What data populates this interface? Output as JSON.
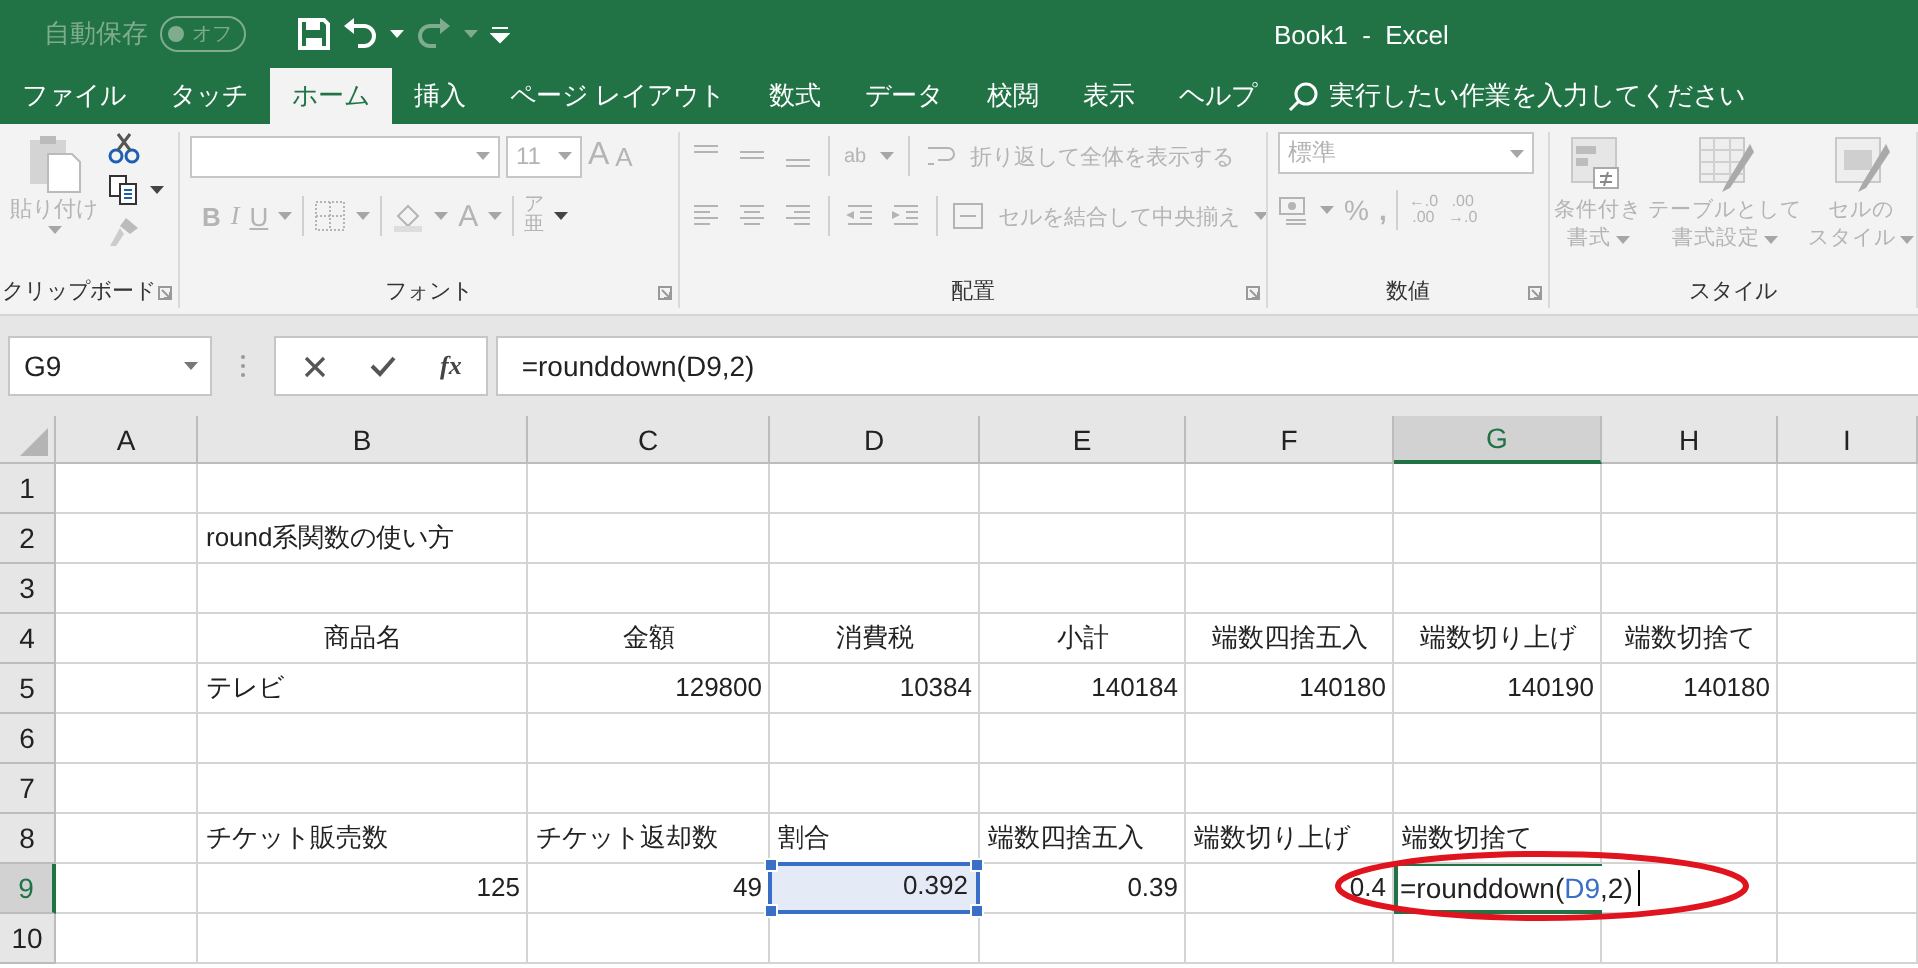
{
  "window": {
    "title": "Book1  -  Excel"
  },
  "quick_access": {
    "autosave_label": "自動保存",
    "autosave": {
      "label": "オフ",
      "on": false
    }
  },
  "tabs": [
    {
      "label": "ファイル",
      "selected": false
    },
    {
      "label": "タッチ",
      "selected": false
    },
    {
      "label": "ホーム",
      "selected": true
    },
    {
      "label": "挿入",
      "selected": false
    },
    {
      "label": "ページ レイアウト",
      "selected": false
    },
    {
      "label": "数式",
      "selected": false
    },
    {
      "label": "データ",
      "selected": false
    },
    {
      "label": "校閲",
      "selected": false
    },
    {
      "label": "表示",
      "selected": false
    },
    {
      "label": "ヘルプ",
      "selected": false
    }
  ],
  "tell_me": {
    "placeholder": "実行したい作業を入力してください"
  },
  "ribbon": {
    "disabled": true,
    "clipboard": {
      "paste": "貼り付け",
      "label": "クリップボード"
    },
    "font": {
      "font_size": "11",
      "grow": "A",
      "shrink": "A",
      "bold": "B",
      "italic": "I",
      "underline": "U",
      "font_color": "A",
      "phonetic": "ア亜",
      "label": "フォント"
    },
    "alignment": {
      "orientation": "ab",
      "wrap": "折り返して全体を表示する",
      "merge": "セルを結合して中央揃え",
      "label": "配置"
    },
    "number": {
      "format": "標準",
      "percent": "%",
      "comma": ",",
      "increase_decimal": [
        "←.0",
        ".00"
      ],
      "decrease_decimal": [
        ".00",
        "→.0"
      ],
      "label": "数値"
    },
    "styles": {
      "buttons": [
        {
          "lines": [
            "条件付き",
            "書式"
          ]
        },
        {
          "lines": [
            "テーブルとして",
            "書式設定"
          ]
        },
        {
          "lines": [
            "セルの",
            "スタイル"
          ]
        }
      ],
      "label": "スタイル"
    }
  },
  "formula_bar": {
    "name_box": "G9",
    "function_button": "fx",
    "formula": "=rounddown(D9,2)"
  },
  "sheet": {
    "columns": [
      {
        "label": "A",
        "selected": false
      },
      {
        "label": "B",
        "selected": false
      },
      {
        "label": "C",
        "selected": false
      },
      {
        "label": "D",
        "selected": false
      },
      {
        "label": "E",
        "selected": false
      },
      {
        "label": "F",
        "selected": false
      },
      {
        "label": "G",
        "selected": true
      },
      {
        "label": "H",
        "selected": false
      },
      {
        "label": "I",
        "selected": false
      }
    ],
    "rows": [
      {
        "label": "1",
        "selected": false,
        "cells": [
          {
            "kind": "empty"
          },
          {
            "kind": "empty"
          },
          {
            "kind": "empty"
          },
          {
            "kind": "empty"
          },
          {
            "kind": "empty"
          },
          {
            "kind": "empty"
          },
          {
            "kind": "empty"
          },
          {
            "kind": "empty"
          },
          {
            "kind": "empty"
          }
        ]
      },
      {
        "label": "2",
        "selected": false,
        "cells": [
          {
            "kind": "empty"
          },
          {
            "kind": "text",
            "text": "round系関数の使い方"
          },
          {
            "kind": "empty"
          },
          {
            "kind": "empty"
          },
          {
            "kind": "empty"
          },
          {
            "kind": "empty"
          },
          {
            "kind": "empty"
          },
          {
            "kind": "empty"
          },
          {
            "kind": "empty"
          }
        ]
      },
      {
        "label": "3",
        "selected": false,
        "cells": [
          {
            "kind": "empty"
          },
          {
            "kind": "empty"
          },
          {
            "kind": "empty"
          },
          {
            "kind": "empty"
          },
          {
            "kind": "empty"
          },
          {
            "kind": "empty"
          },
          {
            "kind": "empty"
          },
          {
            "kind": "empty"
          },
          {
            "kind": "empty"
          }
        ]
      },
      {
        "label": "4",
        "selected": false,
        "cells": [
          {
            "kind": "empty"
          },
          {
            "kind": "heading",
            "text": "商品名"
          },
          {
            "kind": "heading",
            "text": "金額"
          },
          {
            "kind": "heading",
            "text": "消費税"
          },
          {
            "kind": "heading",
            "text": "小計"
          },
          {
            "kind": "heading",
            "text": "端数四捨五入"
          },
          {
            "kind": "heading",
            "text": "端数切り上げ"
          },
          {
            "kind": "heading",
            "text": "端数切捨て"
          },
          {
            "kind": "empty"
          }
        ]
      },
      {
        "label": "5",
        "selected": false,
        "cells": [
          {
            "kind": "empty"
          },
          {
            "kind": "text",
            "text": "テレビ"
          },
          {
            "kind": "number",
            "text": "129800"
          },
          {
            "kind": "number",
            "text": "10384"
          },
          {
            "kind": "number",
            "text": "140184"
          },
          {
            "kind": "number",
            "text": "140180"
          },
          {
            "kind": "number",
            "text": "140190"
          },
          {
            "kind": "number",
            "text": "140180"
          },
          {
            "kind": "empty"
          }
        ]
      },
      {
        "label": "6",
        "selected": false,
        "cells": [
          {
            "kind": "empty"
          },
          {
            "kind": "empty"
          },
          {
            "kind": "empty"
          },
          {
            "kind": "empty"
          },
          {
            "kind": "empty"
          },
          {
            "kind": "empty"
          },
          {
            "kind": "empty"
          },
          {
            "kind": "empty"
          },
          {
            "kind": "empty"
          }
        ]
      },
      {
        "label": "7",
        "selected": false,
        "cells": [
          {
            "kind": "empty"
          },
          {
            "kind": "empty"
          },
          {
            "kind": "empty"
          },
          {
            "kind": "empty"
          },
          {
            "kind": "empty"
          },
          {
            "kind": "empty"
          },
          {
            "kind": "empty"
          },
          {
            "kind": "empty"
          },
          {
            "kind": "empty"
          }
        ]
      },
      {
        "label": "8",
        "selected": false,
        "cells": [
          {
            "kind": "empty"
          },
          {
            "kind": "text",
            "text": "チケット販売数"
          },
          {
            "kind": "text",
            "text": "チケット返却数"
          },
          {
            "kind": "text",
            "text": "割合"
          },
          {
            "kind": "text",
            "text": "端数四捨五入"
          },
          {
            "kind": "text",
            "text": "端数切り上げ"
          },
          {
            "kind": "text",
            "text": "端数切捨て"
          },
          {
            "kind": "empty"
          },
          {
            "kind": "empty"
          }
        ]
      },
      {
        "label": "9",
        "selected": true,
        "cells": [
          {
            "kind": "empty"
          },
          {
            "kind": "number",
            "text": "125"
          },
          {
            "kind": "number",
            "text": "49"
          },
          {
            "kind": "reference",
            "text": "0.392"
          },
          {
            "kind": "number",
            "text": "0.39"
          },
          {
            "kind": "number",
            "text": "0.4"
          },
          {
            "kind": "editor",
            "parts": [
              {
                "text": "=rounddown(",
                "kind": "plain"
              },
              {
                "text": "D9",
                "kind": "reference"
              },
              {
                "text": ",2)",
                "kind": "plain"
              }
            ]
          },
          {
            "kind": "empty"
          },
          {
            "kind": "empty"
          }
        ]
      },
      {
        "label": "10",
        "selected": false,
        "cells": [
          {
            "kind": "empty"
          },
          {
            "kind": "empty"
          },
          {
            "kind": "empty"
          },
          {
            "kind": "empty"
          },
          {
            "kind": "empty"
          },
          {
            "kind": "empty"
          },
          {
            "kind": "empty"
          },
          {
            "kind": "empty"
          },
          {
            "kind": "empty"
          }
        ]
      }
    ]
  }
}
